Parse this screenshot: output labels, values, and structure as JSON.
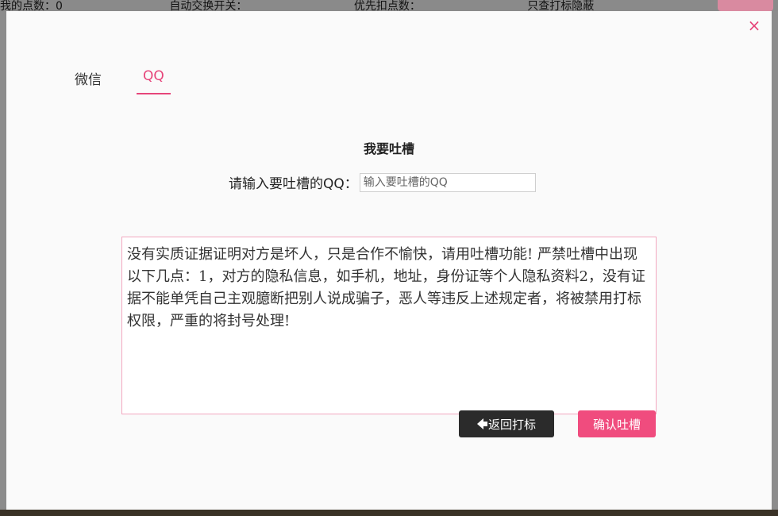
{
  "modal": {
    "close_label": "×",
    "tabs": [
      {
        "label": "微信",
        "active": false
      },
      {
        "label": "QQ",
        "active": true
      }
    ],
    "form_title": "我要吐槽",
    "qq_label": "请输入要吐槽的QQ：",
    "qq_placeholder": "输入要吐槽的QQ",
    "qq_value": "",
    "complaint_text": "没有实质证据证明对方是坏人，只是合作不愉快，请用吐槽功能! 严禁吐槽中出现以下几点：1，对方的隐私信息，如手机，地址，身份证等个人隐私资料2，没有证据不能单凭自己主观臆断把别人说成骗子，恶人等违反上述规定者，将被禁用打标权限，严重的将封号处理!",
    "back_button": "返回打标",
    "confirm_button": "确认吐槽"
  },
  "background": {
    "top_texts": [
      "我的点数：0",
      "自动交换开关：",
      "优先扣点数：",
      "只查打标隐蔽"
    ]
  },
  "colors": {
    "accent": "#e6457a",
    "confirm": "#f04c7e",
    "dark_button": "#2b2b2b"
  }
}
